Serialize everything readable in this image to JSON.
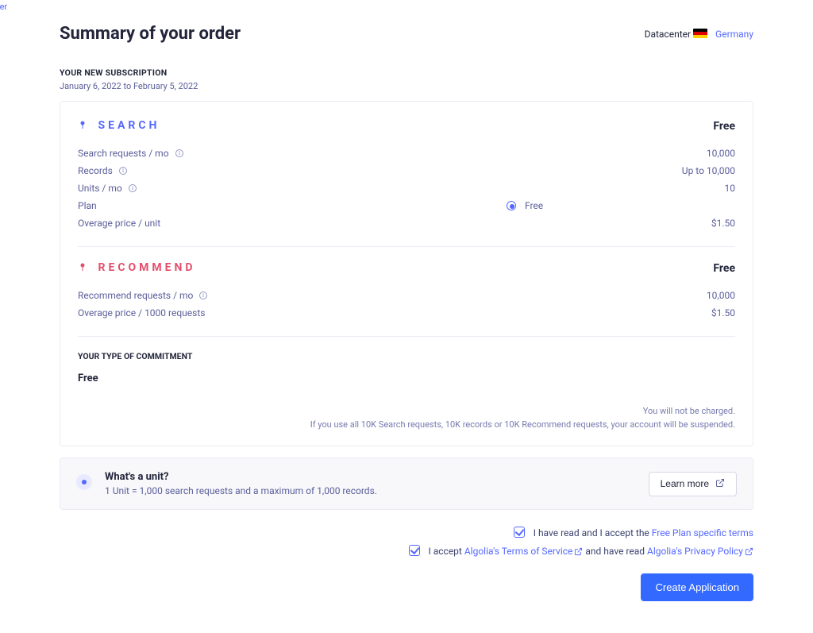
{
  "partial_left": "ter",
  "header": {
    "title": "Summary of your order",
    "datacenter_label": "Datacenter",
    "country": "Germany"
  },
  "subscription": {
    "label": "YOUR NEW SUBSCRIPTION",
    "date_range": "January 6, 2022 to February 5, 2022"
  },
  "search": {
    "title": "SEARCH",
    "free_label": "Free",
    "rows": {
      "requests_label": "Search requests / mo",
      "requests_value": "10,000",
      "records_label": "Records",
      "records_value": "Up to 10,000",
      "units_label": "Units / mo",
      "units_value": "10",
      "plan_label": "Plan",
      "plan_value": "Free",
      "overage_label": "Overage price / unit",
      "overage_value": "$1.50"
    }
  },
  "recommend": {
    "title": "RECOMMEND",
    "free_label": "Free",
    "rows": {
      "requests_label": "Recommend requests / mo",
      "requests_value": "10,000",
      "overage_label": "Overage price / 1000 requests",
      "overage_value": "$1.50"
    }
  },
  "commitment": {
    "label": "YOUR TYPE OF COMMITMENT",
    "value": "Free"
  },
  "notice": {
    "line1": "You will not be charged.",
    "line2": "If you use all 10K Search requests, 10K records or 10K Recommend requests, your account will be suspended."
  },
  "unit_box": {
    "title": "What's a unit?",
    "desc": "1 Unit = 1,000 search requests and a maximum of 1,000 records.",
    "button": "Learn more"
  },
  "checks": {
    "line1_prefix": "I have read and I accept the ",
    "line1_link": "Free Plan specific terms",
    "line2_prefix": "I accept ",
    "line2_link1": "Algolia's Terms of Service",
    "line2_mid": " and have read ",
    "line2_link2": "Algolia's Privacy Policy"
  },
  "cta": {
    "label": "Create Application"
  }
}
